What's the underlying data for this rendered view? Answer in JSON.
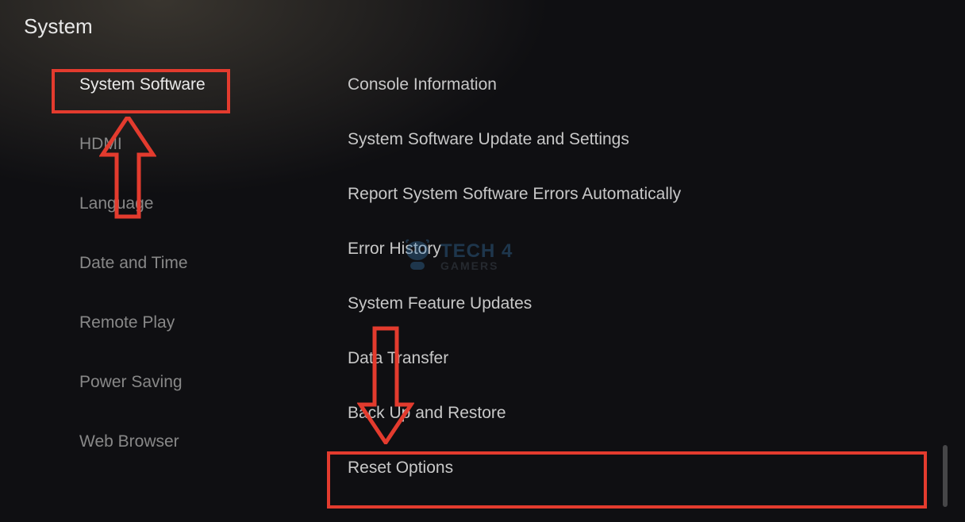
{
  "header": {
    "title": "System"
  },
  "sidebar": {
    "items": [
      {
        "label": "System Software",
        "selected": true
      },
      {
        "label": "HDMI",
        "selected": false
      },
      {
        "label": "Language",
        "selected": false
      },
      {
        "label": "Date and Time",
        "selected": false
      },
      {
        "label": "Remote Play",
        "selected": false
      },
      {
        "label": "Power Saving",
        "selected": false
      },
      {
        "label": "Web Browser",
        "selected": false
      }
    ]
  },
  "main": {
    "items": [
      {
        "label": "Console Information"
      },
      {
        "label": "System Software Update and Settings"
      },
      {
        "label": "Report System Software Errors Automatically"
      },
      {
        "label": "Error History"
      },
      {
        "label": "System Feature Updates"
      },
      {
        "label": "Data Transfer"
      },
      {
        "label": "Back Up and Restore"
      },
      {
        "label": "Reset Options"
      }
    ]
  },
  "watermark": {
    "line1": "TECH 4",
    "line2": "GAMERS"
  },
  "annotation": {
    "color": "#e33b2e"
  }
}
